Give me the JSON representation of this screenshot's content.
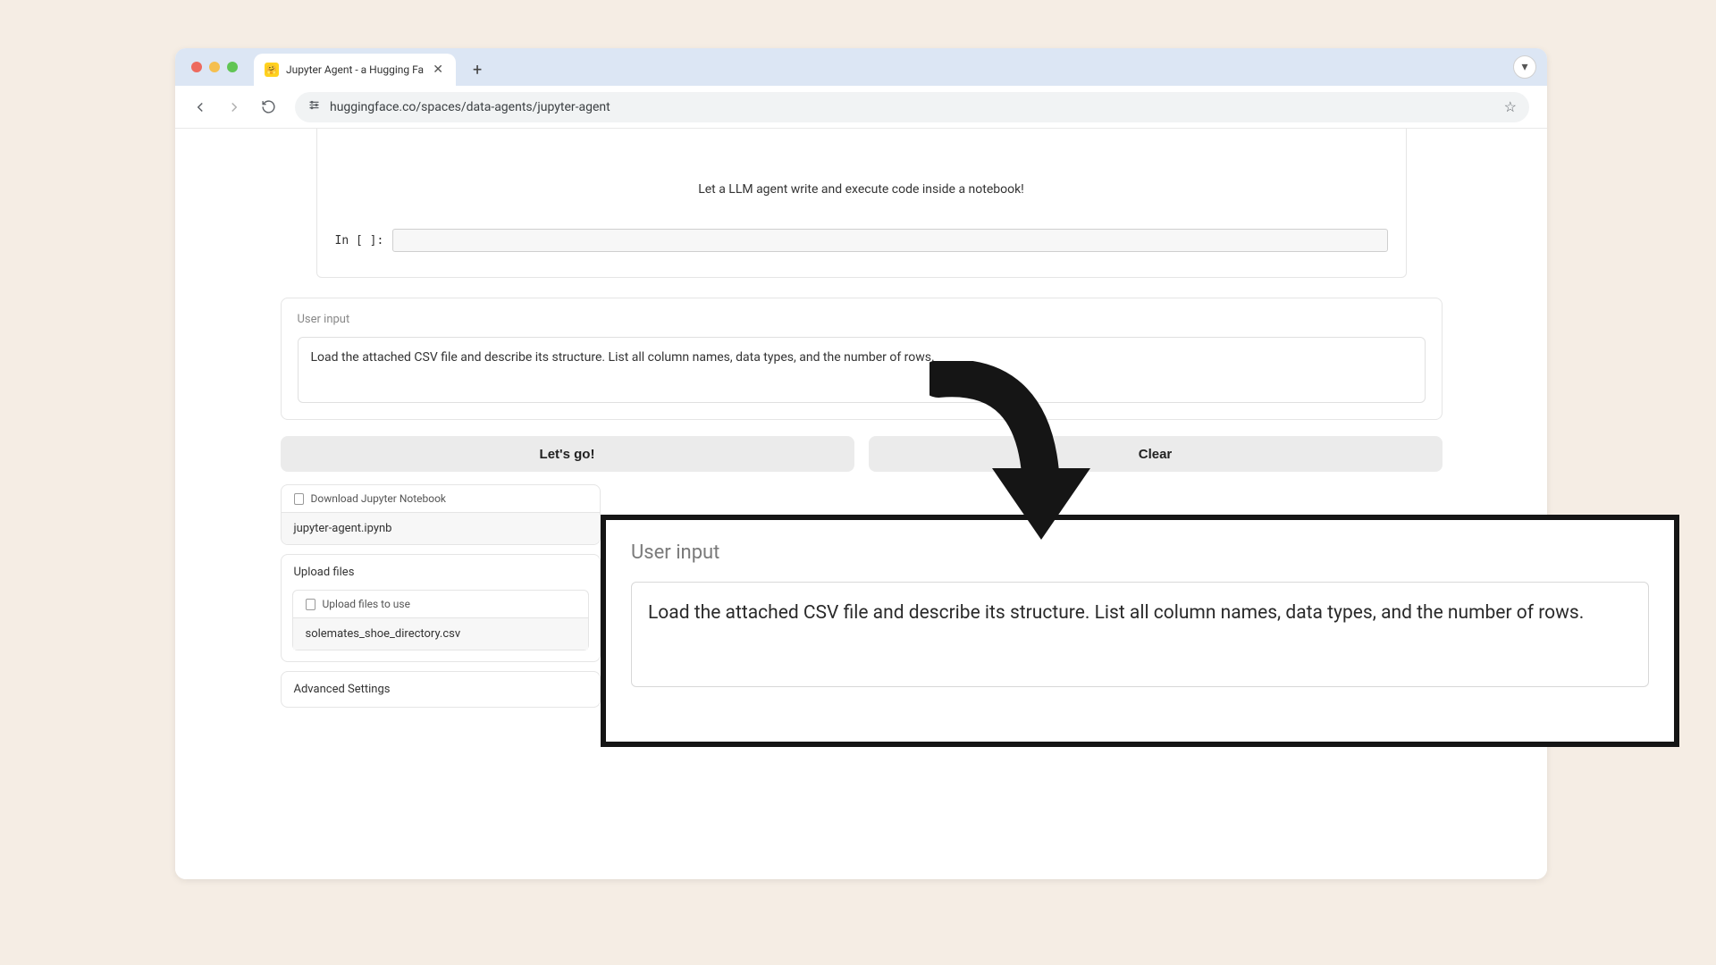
{
  "tab": {
    "title": "Jupyter Agent - a Hugging Fa",
    "favicon_glyph": "🤗"
  },
  "address_bar": {
    "url": "huggingface.co/spaces/data-agents/jupyter-agent"
  },
  "notebook": {
    "description": "Let a LLM agent write and execute code inside a notebook!",
    "cell_prompt": "In [ ]:"
  },
  "user_input": {
    "label": "User input",
    "value": "Load the attached CSV file and describe its structure. List all column names, data types, and the number of rows."
  },
  "buttons": {
    "go": "Let's go!",
    "clear": "Clear"
  },
  "download_section": {
    "header": "Download Jupyter Notebook",
    "filename": "jupyter-agent.ipynb"
  },
  "upload_section": {
    "title": "Upload files",
    "button_label": "Upload files to use",
    "filename": "solemates_shoe_directory.csv"
  },
  "advanced": {
    "label": "Advanced Settings"
  },
  "callout": {
    "label": "User input",
    "value": "Load the attached CSV file and describe its structure. List all column names, data types, and the number of rows."
  }
}
